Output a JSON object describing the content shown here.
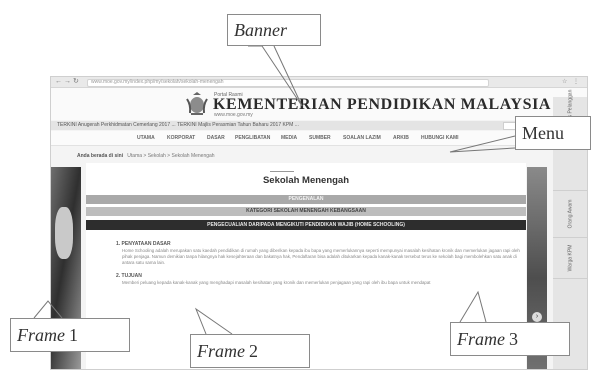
{
  "callouts": {
    "banner": "Banner",
    "menu": "Menu",
    "frame1_word": "Frame",
    "frame1_num": "1",
    "frame2_word": "Frame",
    "frame2_num": "2",
    "frame3_word": "Frame",
    "frame3_num": "3"
  },
  "browser": {
    "url": "www.moe.gov.my/index.php/my/sekolah/sekolah-menengah"
  },
  "header": {
    "portal_label": "Portal Rasmi",
    "ministry_title": "KEMENTERIAN PENDIDIKAN MALAYSIA",
    "site_url": "www.moe.gov.my"
  },
  "ticker": {
    "text": "TERKINI Anugerah Perkhidmatan Cemerlang 2017 ... TERKINI Majlis Perasmian Tahun Baharu 2017 KPM ..."
  },
  "menu": {
    "items": [
      "UTAMA",
      "KORPORAT",
      "DASAR",
      "PENGLIBATAN",
      "MEDIA",
      "SUMBER",
      "SOALAN LAZIM",
      "ARKIB",
      "HUBUNGI KAMI"
    ]
  },
  "breadcrumb": {
    "prefix": "Anda berada di sini",
    "path": "Utama > Sekolah > Sekolah Menengah"
  },
  "content": {
    "page_title": "Sekolah Menengah",
    "band_1": "PENGENALAN",
    "band_2": "KATEGORI SEKOLAH MENENGAH KEBANGSAAN",
    "band_3": "PENGECUALIAN DARIPADA MENGIKUTI PENDIDIKAN WAJIB (HOME SCHOOLING)",
    "section_1_head": "1. PENYATAAN DASAR",
    "section_1_body": "Home Schooling adalah merupakan satu kaedah pendidikan di rumah yang diberikan kepada ibu bapa yang memerlukannya seperti mempunyai masalah kesihatan kronik dan memerlukan jagaan rapi oleh pihak penjaga. Namun demikian tanpa hilangnya hak kesejahteraan dan bakatnya hak, Pendaftaran bisa adalah ditukarkan kepada kanak-kanak tersebut terus ke sekolah bagi membolehkan satu anak di antara satu sama lain.",
    "section_2_head": "2. TUJUAN",
    "section_2_body": "Memberi peluang kepada kanak-kanak yang menghadapi masalah kesihatan yang kronik dan memerlukan penjagaan yang rapi oleh ibu bapa untuk mendapat"
  },
  "side_tabs": [
    "Maklumbalas Pelanggan",
    "Orang Awam",
    "Warga KPM"
  ],
  "icons": {
    "crest": "coat-of-arms-icon",
    "scroll": "chevron-right-icon"
  }
}
